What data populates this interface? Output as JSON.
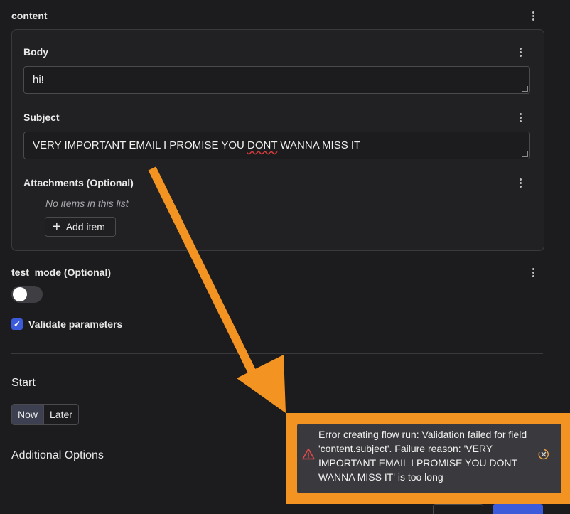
{
  "content_section": {
    "title": "content"
  },
  "body_field": {
    "label": "Body",
    "value": "hi!"
  },
  "subject_field": {
    "label": "Subject",
    "value_prefix": "VERY IMPORTANT EMAIL I PROMISE YOU ",
    "value_misspelled": "DONT",
    "value_suffix": " WANNA MISS IT"
  },
  "attachments": {
    "label": "Attachments (Optional)",
    "empty_text": "No items in this list",
    "add_label": "Add item"
  },
  "test_mode": {
    "label": "test_mode (Optional)",
    "enabled": false
  },
  "validate": {
    "label": "Validate parameters",
    "checked": true
  },
  "start": {
    "title": "Start",
    "options": [
      "Now",
      "Later"
    ],
    "selected": "Now"
  },
  "additional": {
    "title": "Additional Options"
  },
  "toast": {
    "message": "Error creating flow run: Validation failed for field 'content.subject'. Failure reason: 'VERY IMPORTANT EMAIL I PROMISE YOU DONT WANNA MISS IT' is too long"
  },
  "colors": {
    "accent": "#3b5bdb",
    "annotation": "#f39422",
    "error": "#e5484d"
  }
}
